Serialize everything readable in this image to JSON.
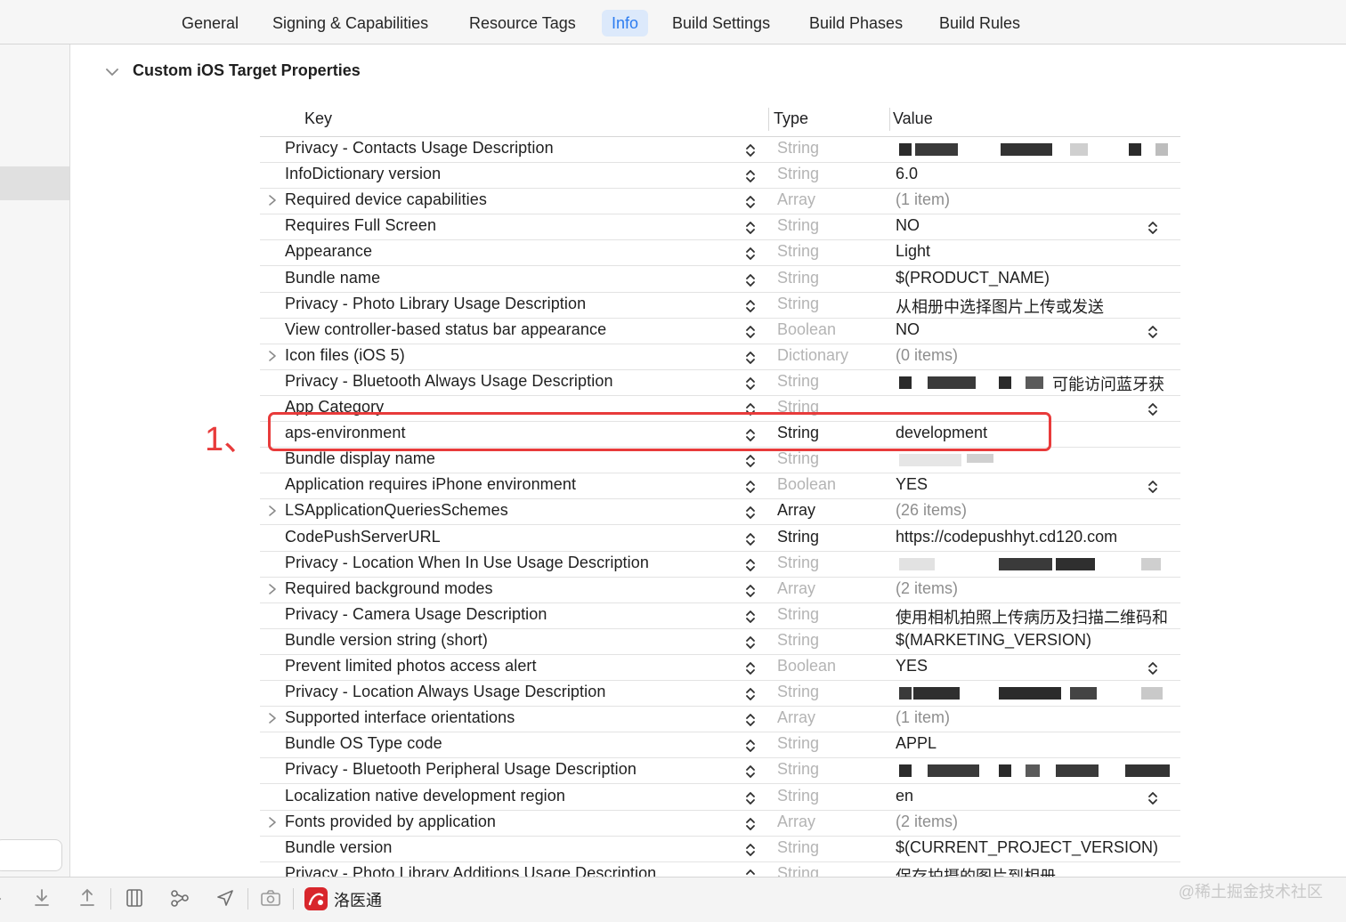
{
  "tabs": [
    {
      "label": "General",
      "active": false
    },
    {
      "label": "Signing & Capabilities",
      "active": false
    },
    {
      "label": "Resource Tags",
      "active": false
    },
    {
      "label": "Info",
      "active": true
    },
    {
      "label": "Build Settings",
      "active": false
    },
    {
      "label": "Build Phases",
      "active": false
    },
    {
      "label": "Build Rules",
      "active": false
    }
  ],
  "section": {
    "title": "Custom iOS Target Properties"
  },
  "table": {
    "columns": [
      "Key",
      "Type",
      "Value"
    ],
    "rows": [
      {
        "key": "Privacy - Contacts Usage Description",
        "type": "String",
        "value": "",
        "redacted": true
      },
      {
        "key": "InfoDictionary version",
        "type": "String",
        "value": "6.0"
      },
      {
        "key": "Required device capabilities",
        "type": "Array",
        "value": "(1 item)",
        "expandable": true
      },
      {
        "key": "Requires Full Screen",
        "type": "String",
        "value": "NO",
        "value_stepper": true
      },
      {
        "key": "Appearance",
        "type": "String",
        "value": "Light"
      },
      {
        "key": "Bundle name",
        "type": "String",
        "value": "$(PRODUCT_NAME)"
      },
      {
        "key": "Privacy - Photo Library Usage Description",
        "type": "String",
        "value": "从相册中选择图片上传或发送"
      },
      {
        "key": "View controller-based status bar appearance",
        "type": "Boolean",
        "value": "NO",
        "value_stepper": true
      },
      {
        "key": "Icon files (iOS 5)",
        "type": "Dictionary",
        "value": "(0 items)",
        "expandable": true
      },
      {
        "key": "Privacy - Bluetooth Always Usage Description",
        "type": "String",
        "value": "可能访问蓝牙获",
        "redacted": true
      },
      {
        "key": "App Category",
        "type": "String",
        "value": "",
        "value_stepper": true
      },
      {
        "key": "aps-environment",
        "type": "String",
        "value": "development",
        "type_dark": true
      },
      {
        "key": "Bundle display name",
        "type": "String",
        "value": "",
        "redacted": true
      },
      {
        "key": "Application requires iPhone environment",
        "type": "Boolean",
        "value": "YES",
        "value_stepper": true
      },
      {
        "key": "LSApplicationQueriesSchemes",
        "type": "Array",
        "value": "(26 items)",
        "expandable": true,
        "type_dark": true
      },
      {
        "key": "CodePushServerURL",
        "type": "String",
        "value": "https://codepushhyt.cd120.com",
        "type_dark": true
      },
      {
        "key": "Privacy - Location When In Use Usage Description",
        "type": "String",
        "value": "",
        "redacted": true
      },
      {
        "key": "Required background modes",
        "type": "Array",
        "value": "(2 items)",
        "expandable": true
      },
      {
        "key": "Privacy - Camera Usage Description",
        "type": "String",
        "value": "使用相机拍照上传病历及扫描二维码和"
      },
      {
        "key": "Bundle version string (short)",
        "type": "String",
        "value": "$(MARKETING_VERSION)"
      },
      {
        "key": "Prevent limited photos access alert",
        "type": "Boolean",
        "value": "YES",
        "value_stepper": true
      },
      {
        "key": "Privacy - Location Always Usage Description",
        "type": "String",
        "value": "",
        "redacted": true
      },
      {
        "key": "Supported interface orientations",
        "type": "Array",
        "value": "(1 item)",
        "expandable": true
      },
      {
        "key": "Bundle OS Type code",
        "type": "String",
        "value": "APPL"
      },
      {
        "key": "Privacy - Bluetooth Peripheral Usage Description",
        "type": "String",
        "value": "",
        "redacted": true
      },
      {
        "key": "Localization native development region",
        "type": "String",
        "value": "en",
        "value_stepper": true
      },
      {
        "key": "Fonts provided by application",
        "type": "Array",
        "value": "(2 items)",
        "expandable": true
      },
      {
        "key": "Bundle version",
        "type": "String",
        "value": "$(CURRENT_PROJECT_VERSION)"
      },
      {
        "key": "Privacy - Photo Library Additions Usage Description",
        "type": "String",
        "value": "保存拍摄的图片到相册"
      }
    ]
  },
  "annotation": {
    "label": "1、",
    "color": "#e83b3b"
  },
  "toolbar": {
    "icons": [
      "download-icon",
      "upload-icon",
      "split-view-icon",
      "graph-icon",
      "location-arrow-icon",
      "camera-icon"
    ],
    "app_name": "洛医通"
  },
  "watermark": "@稀土掘金技术社区",
  "colors": {
    "accent": "#2c7cf0",
    "active_tab_bg": "#dce9fb",
    "highlight": "#e83b3b",
    "muted_type": "#b4b4b4"
  }
}
